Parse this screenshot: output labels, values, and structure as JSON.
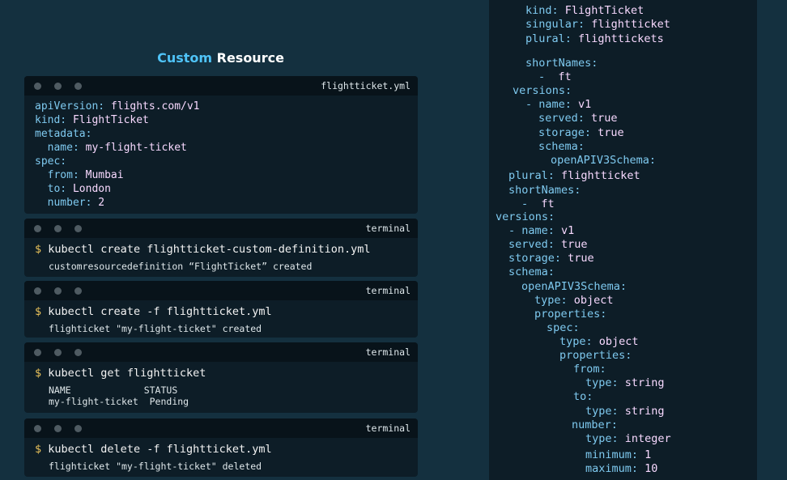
{
  "title": {
    "accent": "Custom",
    "rest": " Resource"
  },
  "windows": [
    {
      "title": "flightticket.yml",
      "lines": [
        {
          "indent": 0,
          "key": "apiVersion:",
          "value": "flights.com/v1"
        },
        {
          "indent": 0,
          "key": "kind:",
          "value": "FlightTicket"
        },
        {
          "indent": 0,
          "key": "metadata:",
          "value": ""
        },
        {
          "indent": 1,
          "key": "name:",
          "value": "my-flight-ticket"
        },
        {
          "indent": 0,
          "key": "spec:",
          "value": ""
        },
        {
          "indent": 1,
          "key": "from:",
          "value": "Mumbai"
        },
        {
          "indent": 1,
          "key": "to:",
          "value": "London"
        },
        {
          "indent": 1,
          "key": "number:",
          "value": "2"
        }
      ]
    }
  ],
  "terminals": [
    {
      "title": "terminal",
      "prompt": "$",
      "command": "kubectl create flightticket-custom-definition.yml",
      "output": [
        "customresourcedefinition “FlightTicket” created"
      ]
    },
    {
      "title": "terminal",
      "prompt": "$",
      "command": "kubectl create -f flightticket.yml",
      "output": [
        "flighticket \"my-flight-ticket\" created"
      ]
    },
    {
      "title": "terminal",
      "prompt": "$",
      "command": "kubectl get flightticket",
      "output": [
        "NAME             STATUS",
        "my-flight-ticket  Pending"
      ]
    },
    {
      "title": "terminal",
      "prompt": "$",
      "command": "kubectl delete -f flightticket.yml",
      "output": [
        "flighticket \"my-flight-ticket\" deleted"
      ]
    }
  ],
  "crd_lines": [
    {
      "key": "kind:",
      "value": "FlightTicket"
    },
    {
      "key": "singular:",
      "value": "flightticket"
    },
    {
      "key": "plural:",
      "value": "flighttickets"
    },
    {
      "key": "shortNames:",
      "value": ""
    },
    {
      "key": "- ",
      "value": "ft"
    },
    {
      "key": "versions:",
      "value": ""
    },
    {
      "key": "- name:",
      "value": "v1"
    },
    {
      "key": "served:",
      "value": "true"
    },
    {
      "key": "storage:",
      "value": "true"
    },
    {
      "key": "schema:",
      "value": ""
    },
    {
      "key": "openAPIV3Schema:",
      "value": ""
    },
    {
      "key": "plural:",
      "value": "flightticket"
    },
    {
      "key": "shortNames:",
      "value": ""
    },
    {
      "key": "- ",
      "value": "ft"
    },
    {
      "key": "versions:",
      "value": ""
    },
    {
      "key": "- name:",
      "value": "v1"
    },
    {
      "key": "served:",
      "value": "true"
    },
    {
      "key": "storage:",
      "value": "true"
    },
    {
      "key": "schema:",
      "value": ""
    },
    {
      "key": "openAPIV3Schema:",
      "value": ""
    },
    {
      "key": "type:",
      "value": "object"
    },
    {
      "key": "properties:",
      "value": ""
    },
    {
      "key": "spec:",
      "value": ""
    },
    {
      "key": "type:",
      "value": "object"
    },
    {
      "key": "properties:",
      "value": ""
    },
    {
      "key": "from:",
      "value": ""
    },
    {
      "key": "type:",
      "value": "string"
    },
    {
      "key": "to:",
      "value": ""
    },
    {
      "key": "type:",
      "value": "string"
    },
    {
      "key": "number:",
      "value": ""
    },
    {
      "key": "type:",
      "value": "integer"
    },
    {
      "key": "minimum:",
      "value": "1"
    },
    {
      "key": "maximum:",
      "value": "10"
    }
  ]
}
